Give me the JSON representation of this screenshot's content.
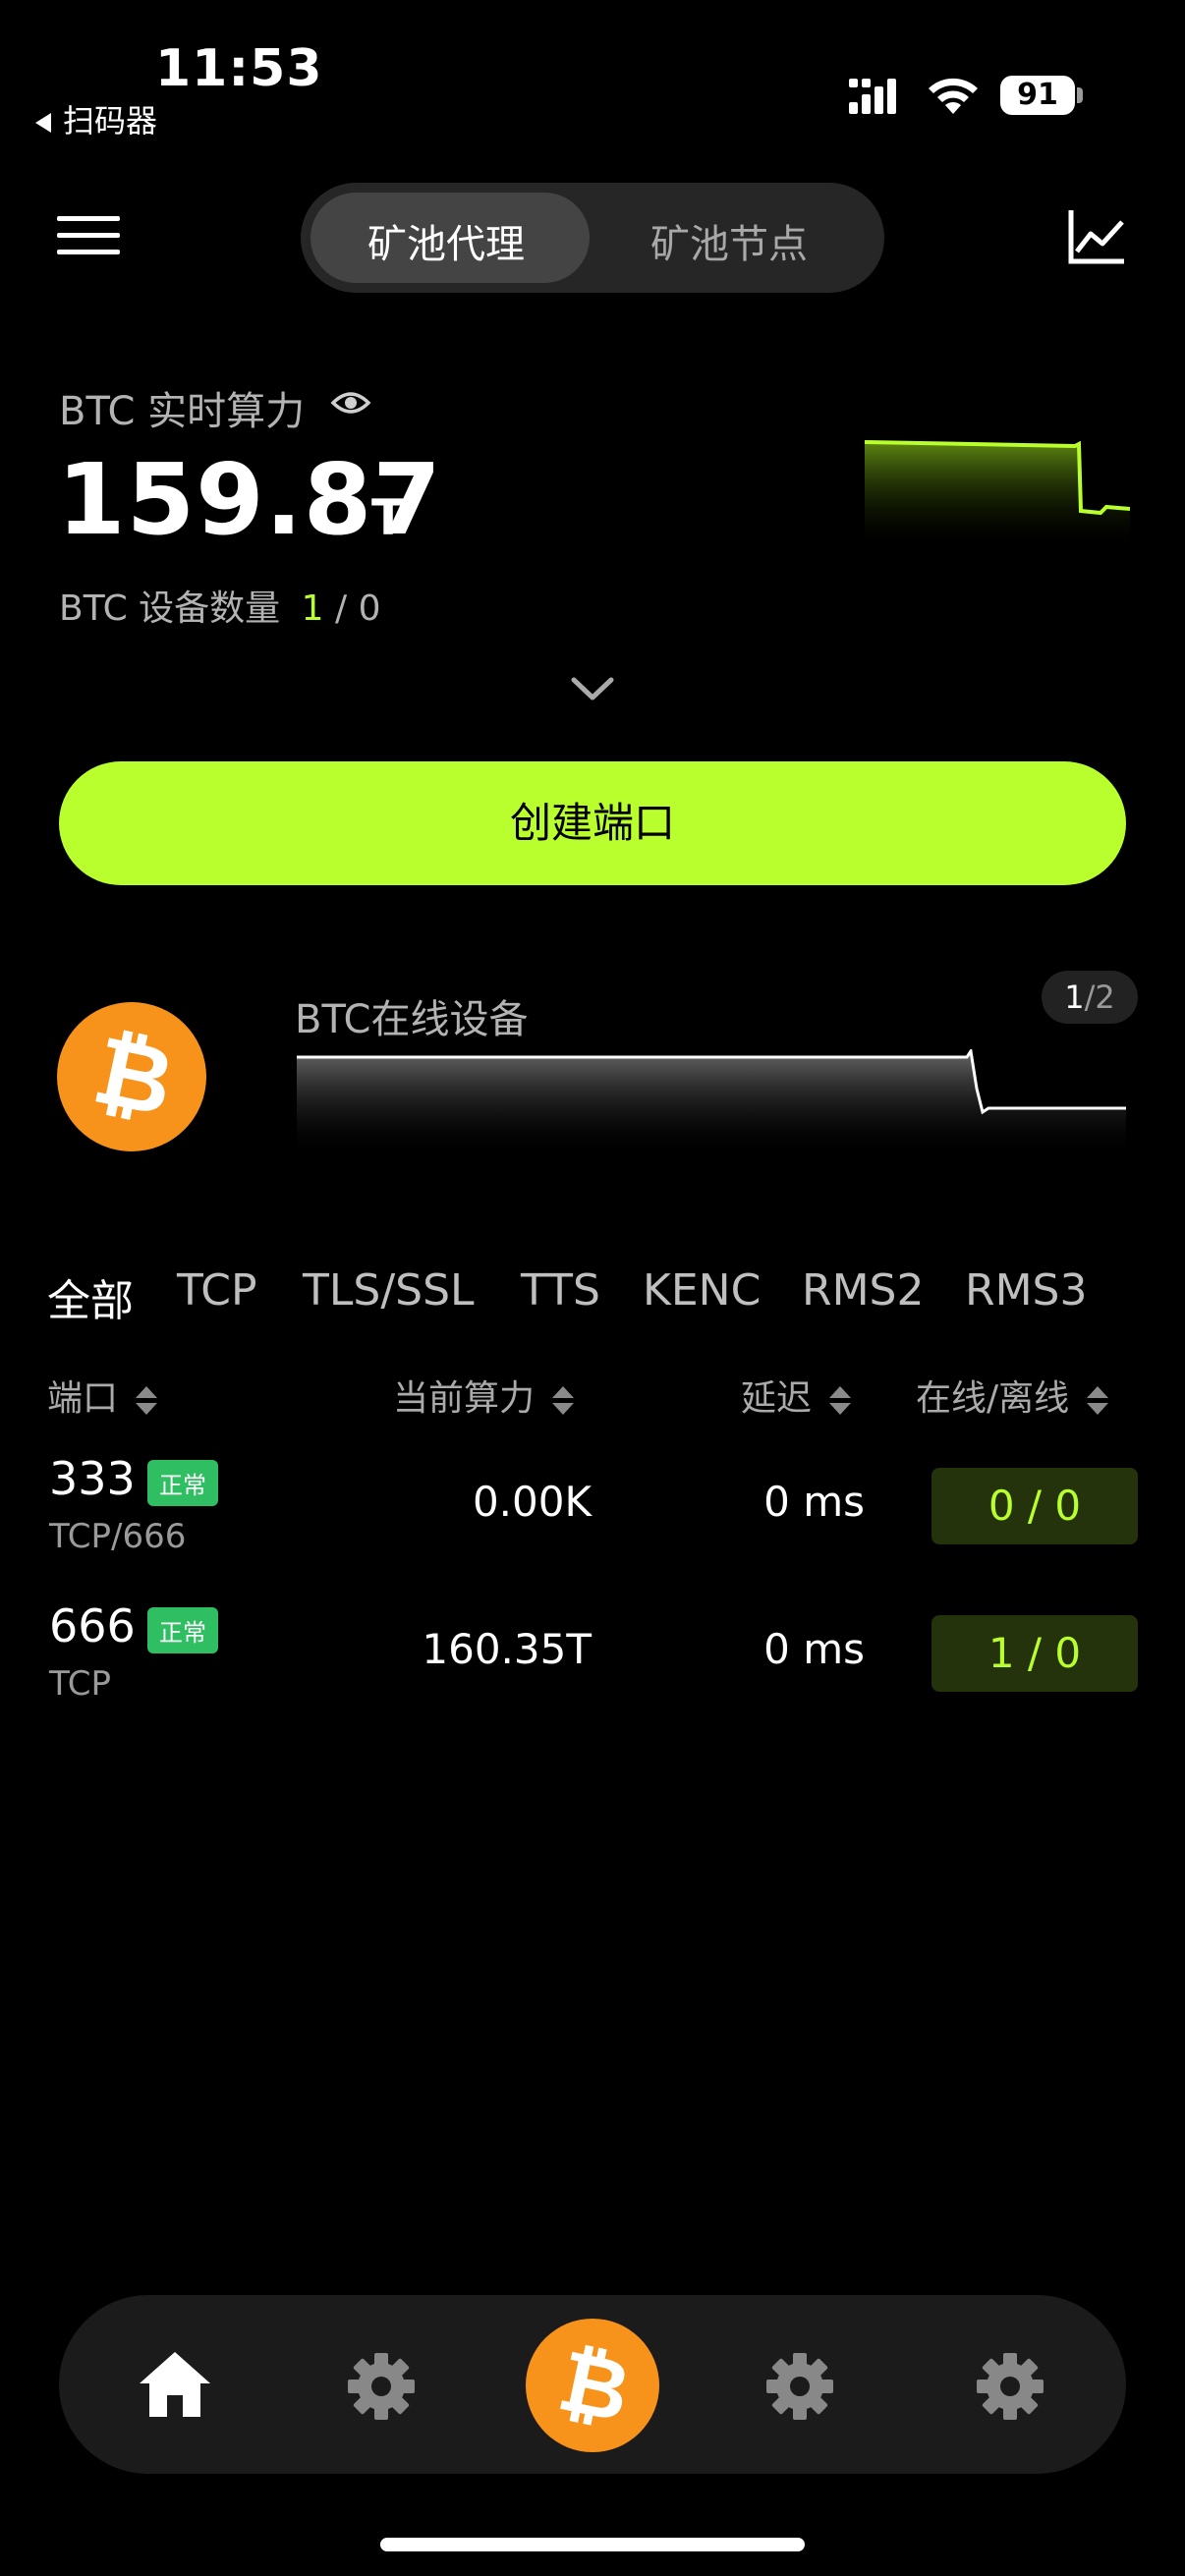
{
  "status_bar": {
    "time": "11:53",
    "back_app": "扫码器",
    "battery": "91"
  },
  "top_bar": {
    "tabs": [
      {
        "label": "矿池代理",
        "active": true
      },
      {
        "label": "矿池节点",
        "active": false
      }
    ]
  },
  "stats": {
    "hashrate_label": "BTC 实时算力",
    "hashrate_value": "159.87",
    "hashrate_unit": "T",
    "device_label": "BTC 设备数量",
    "device_online": "1",
    "device_sep": "/",
    "device_offline": "0"
  },
  "create_button": "创建端口",
  "online_card": {
    "label": "BTC在线设备",
    "page_current": "1",
    "page_total": "/2"
  },
  "filter_tabs": [
    "全部",
    "TCP",
    "TLS/SSL",
    "TTS",
    "KENC",
    "RMS2",
    "RMS3"
  ],
  "table": {
    "headers": {
      "port": "端口",
      "hashrate": "当前算力",
      "latency": "延迟",
      "online": "在线/离线"
    },
    "rows": [
      {
        "port": "333",
        "status": "正常",
        "protocol": "TCP/666",
        "hashrate": "0.00K",
        "latency": "0 ms",
        "online": "0 / 0"
      },
      {
        "port": "666",
        "status": "正常",
        "protocol": "TCP",
        "hashrate": "160.35T",
        "latency": "0 ms",
        "online": "1 / 0"
      }
    ]
  },
  "nav": [
    "home-icon",
    "gear-icon",
    "bitcoin-icon",
    "gear-icon",
    "gear-icon"
  ],
  "colors": {
    "accent": "#b9ff2e",
    "bitcoin": "#f7931a",
    "badge": "#2fbf62",
    "background": "#000000"
  }
}
